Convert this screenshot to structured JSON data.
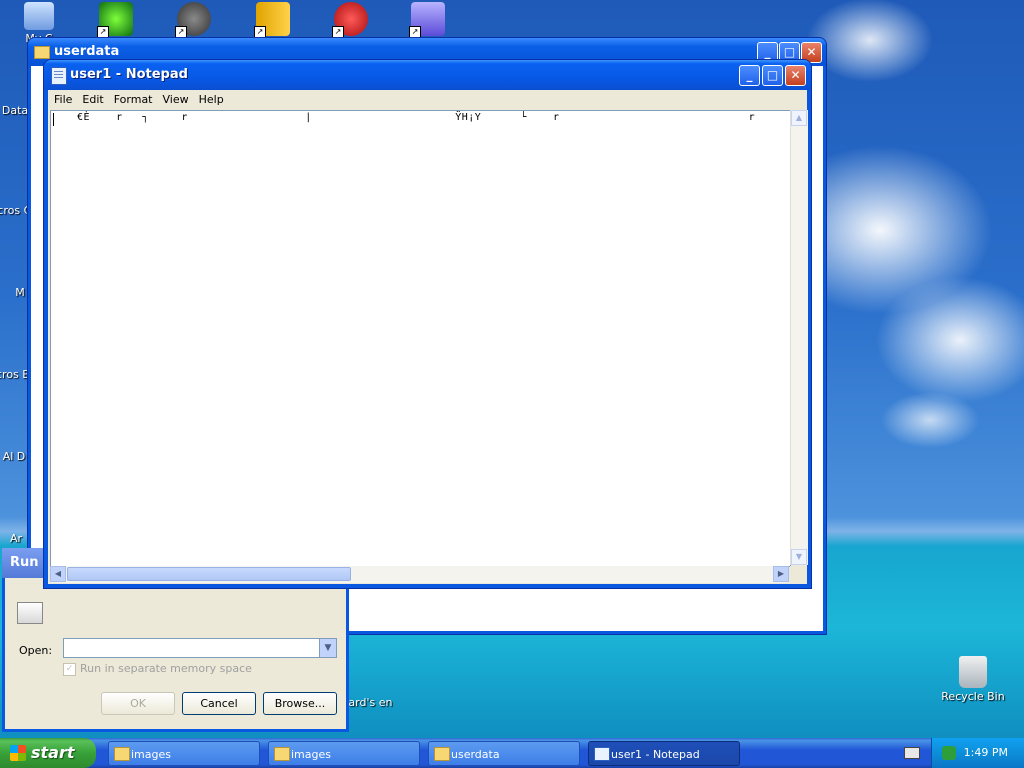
{
  "desktop": {
    "icons": [
      {
        "label": "My C",
        "name": "my-computer-icon"
      },
      {
        "label": "Data",
        "name": "data-icon"
      },
      {
        "label": "Micros C-",
        "name": "microsoft-icon"
      },
      {
        "label": "M",
        "name": "m-icon"
      },
      {
        "label": "Micros Ba",
        "name": "microsoft-ba-icon"
      },
      {
        "label": "Al D",
        "name": "al-icon"
      },
      {
        "label": "Ar",
        "name": "ar-icon"
      },
      {
        "label": "Recycle Bin",
        "name": "recycle-bin-icon"
      },
      {
        "label": "izard's en",
        "name": "wizard-icon"
      }
    ]
  },
  "explorer": {
    "title": "userdata"
  },
  "run_dialog": {
    "title": "Run",
    "open_label": "Open:",
    "open_value": "",
    "checkbox_label": "Run in separate memory space",
    "ok": "OK",
    "cancel": "Cancel",
    "browse": "Browse..."
  },
  "notepad": {
    "title": "user1 - Notepad",
    "menu": [
      "File",
      "Edit",
      "Format",
      "View",
      "Help"
    ],
    "content": "€È    r   ┐     r                  |                      ŸH¡Y      └    r                             r"
  },
  "taskbar": {
    "start": "start",
    "tasks": [
      {
        "label": "images",
        "active": false
      },
      {
        "label": "images",
        "active": false
      },
      {
        "label": "userdata",
        "active": false
      },
      {
        "label": "user1 - Notepad",
        "active": true
      }
    ],
    "clock": "1:49 PM"
  }
}
